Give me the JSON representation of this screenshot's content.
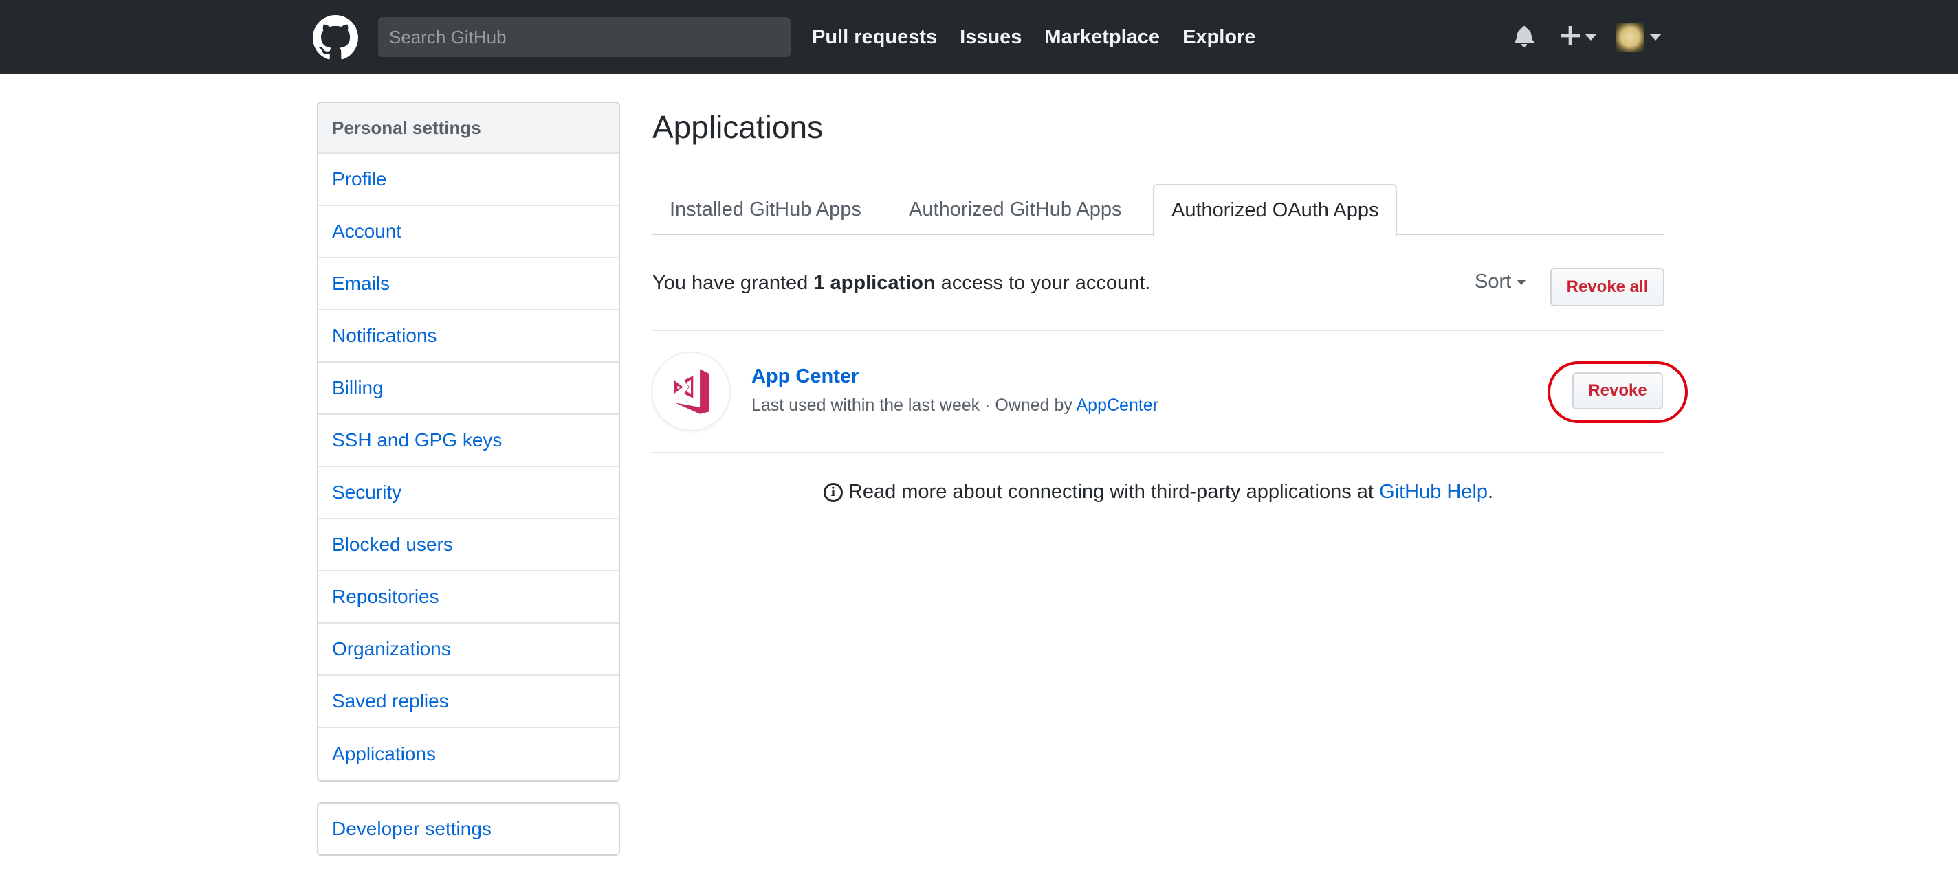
{
  "header": {
    "logo_icon": "github-octocat-icon",
    "search_placeholder": "Search GitHub",
    "nav": [
      "Pull requests",
      "Issues",
      "Marketplace",
      "Explore"
    ],
    "icons": [
      "bell-icon",
      "plus-icon",
      "avatar"
    ]
  },
  "sidebar": {
    "heading": "Personal settings",
    "items": [
      {
        "label": "Profile"
      },
      {
        "label": "Account"
      },
      {
        "label": "Emails"
      },
      {
        "label": "Notifications"
      },
      {
        "label": "Billing"
      },
      {
        "label": "SSH and GPG keys"
      },
      {
        "label": "Security"
      },
      {
        "label": "Blocked users"
      },
      {
        "label": "Repositories"
      },
      {
        "label": "Organizations"
      },
      {
        "label": "Saved replies"
      },
      {
        "label": "Applications"
      }
    ],
    "developer_settings": "Developer settings"
  },
  "main": {
    "title": "Applications",
    "tabs": [
      {
        "label": "Installed GitHub Apps",
        "selected": false
      },
      {
        "label": "Authorized GitHub Apps",
        "selected": false
      },
      {
        "label": "Authorized OAuth Apps",
        "selected": true
      }
    ],
    "grant_prefix": "You have granted ",
    "grant_count": "1 application",
    "grant_suffix": " access to your account.",
    "sort_label": "Sort",
    "revoke_all_label": "Revoke all",
    "apps": [
      {
        "name": "App Center",
        "last_used": "Last used within the last week",
        "separator": " · ",
        "owned_by_label": "Owned by ",
        "owner": "AppCenter",
        "revoke_label": "Revoke"
      }
    ],
    "help_prefix": "Read more about connecting with third-party applications at ",
    "help_link": "GitHub Help",
    "help_suffix": "."
  },
  "colors": {
    "header_bg": "#24292e",
    "link": "#0366d6",
    "danger": "#cb2431",
    "highlight_ring": "#e0000f",
    "app_logo": "#c8285f"
  }
}
